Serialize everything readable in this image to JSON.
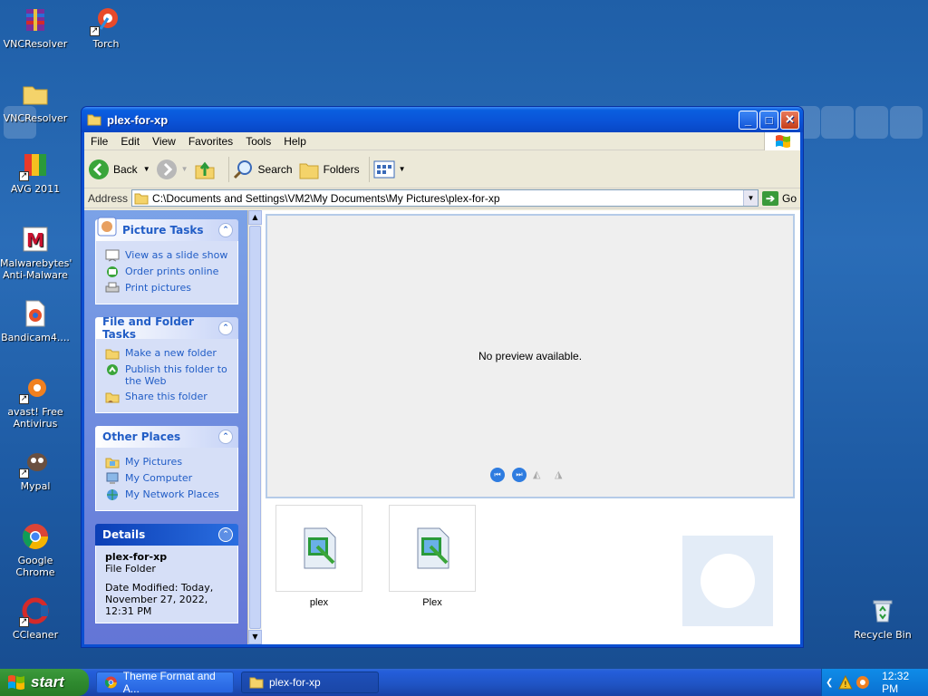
{
  "desktop": {
    "icons": [
      {
        "label": "VNCResolver",
        "icon": "winrar-icon"
      },
      {
        "label": "Torch",
        "icon": "torch-icon"
      },
      {
        "label": "VNCResolver",
        "icon": "folder-icon"
      },
      {
        "label": "AVG 2011",
        "icon": "avg-icon"
      },
      {
        "label": "Malwarebytes' Anti-Malware",
        "icon": "malwarebytes-icon"
      },
      {
        "label": "Bandicam4....",
        "icon": "bandicam-icon"
      },
      {
        "label": "avast! Free Antivirus",
        "icon": "avast-icon"
      },
      {
        "label": "Mypal",
        "icon": "mypal-icon"
      },
      {
        "label": "Google Chrome",
        "icon": "chrome-icon"
      },
      {
        "label": "CCleaner",
        "icon": "ccleaner-icon"
      },
      {
        "label": "Recycle Bin",
        "icon": "recycle-bin-icon"
      }
    ]
  },
  "window": {
    "title": "plex-for-xp",
    "menu": [
      "File",
      "Edit",
      "View",
      "Favorites",
      "Tools",
      "Help"
    ],
    "toolbar": {
      "back": "Back",
      "search": "Search",
      "folders": "Folders"
    },
    "address": {
      "label": "Address",
      "value": "C:\\Documents and Settings\\VM2\\My Documents\\My Pictures\\plex-for-xp",
      "go": "Go"
    },
    "taskpane": {
      "picture_tasks": {
        "title": "Picture Tasks",
        "items": [
          "View as a slide show",
          "Order prints online",
          "Print pictures"
        ]
      },
      "file_folder_tasks": {
        "title": "File and Folder Tasks",
        "items": [
          "Make a new folder",
          "Publish this folder to the Web",
          "Share this folder"
        ]
      },
      "other_places": {
        "title": "Other Places",
        "items": [
          "My Pictures",
          "My Computer",
          "My Network Places"
        ]
      },
      "details": {
        "title": "Details",
        "name": "plex-for-xp",
        "type": "File Folder",
        "modified": "Date Modified: Today, November 27, 2022, 12:31 PM"
      }
    },
    "preview": {
      "message": "No preview available."
    },
    "files": [
      {
        "name": "plex",
        "icon": "image-file-icon"
      },
      {
        "name": "Plex",
        "icon": "image-file-icon"
      }
    ]
  },
  "taskbar": {
    "start": "start",
    "tasks": [
      {
        "label": "Theme Format and A...",
        "icon": "chrome-icon",
        "active": false
      },
      {
        "label": "plex-for-xp",
        "icon": "folder-icon",
        "active": true
      }
    ],
    "clock": "12:32 PM"
  }
}
